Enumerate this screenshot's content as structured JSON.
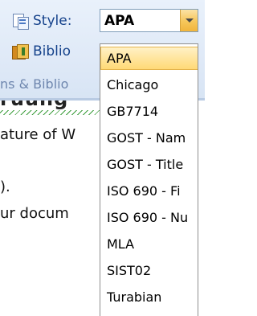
{
  "ribbon": {
    "style_label": "Style:",
    "style_value": "APA",
    "bibliography_label": "Biblio",
    "group_label": "ns & Biblio"
  },
  "document": {
    "heading_fragment": "ruung",
    "lines": [
      "ature of W",
      "",
      ").",
      "ur docum"
    ]
  },
  "style_dropdown": {
    "selected": "APA",
    "options": [
      "APA",
      "Chicago",
      "GB7714",
      "GOST - Nam",
      "GOST - Title",
      "ISO 690 - Fi",
      "ISO 690 - Nu",
      "MLA",
      "SIST02",
      "Turabian"
    ]
  }
}
